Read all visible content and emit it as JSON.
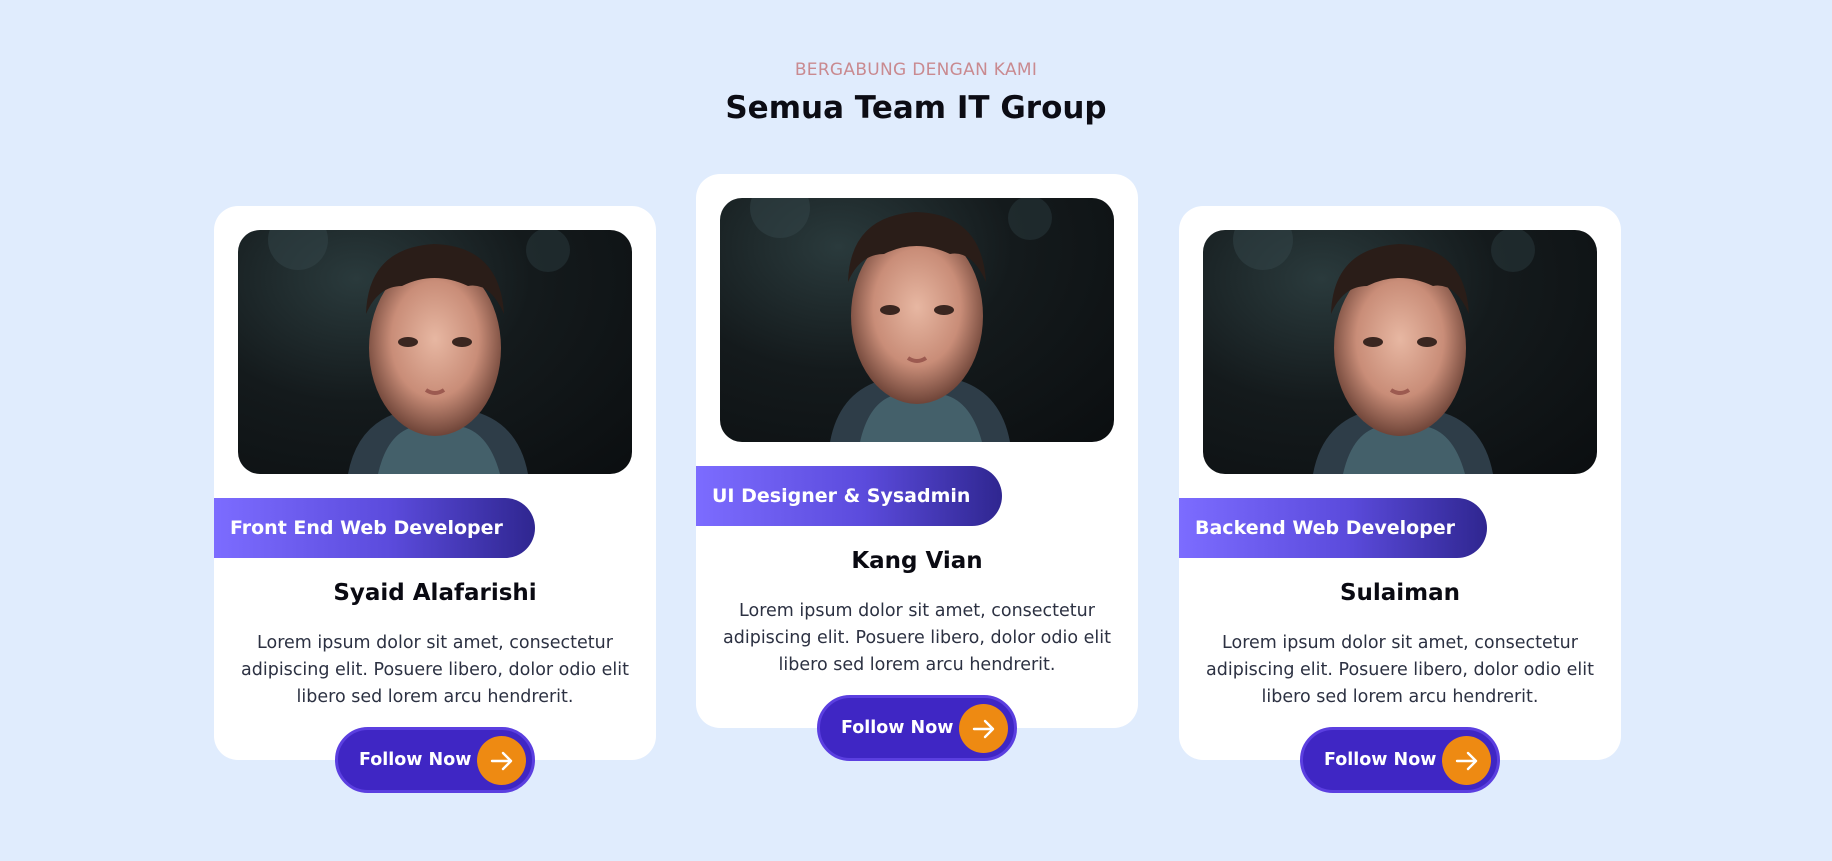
{
  "header": {
    "eyebrow": "BERGABUNG DENGAN KAMI",
    "title": "Semua Team IT Group"
  },
  "colors": {
    "background": "#e0ecfd",
    "card": "#ffffff",
    "accent_purple": "#3f26c4",
    "accent_orange": "#ee8a12",
    "role_gradient_start": "#7c6cff",
    "role_gradient_end": "#2f2690",
    "eyebrow": "#c98a90"
  },
  "cards": [
    {
      "role": "Front End Web Developer",
      "name": "Syaid Alafarishi",
      "description": "Lorem ipsum dolor sit amet, consectetur adipiscing elit. Posuere libero, dolor odio elit libero sed lorem arcu hendrerit.",
      "button_label": "Follow Now",
      "button_icon": "arrow-right-icon",
      "photo": "team-member-photo"
    },
    {
      "role": "UI Designer & Sysadmin",
      "name": "Kang Vian",
      "description": "Lorem ipsum dolor sit amet, consectetur adipiscing elit. Posuere libero, dolor odio elit libero sed lorem arcu hendrerit.",
      "button_label": "Follow Now",
      "button_icon": "arrow-right-icon",
      "photo": "team-member-photo"
    },
    {
      "role": "Backend Web Developer",
      "name": "Sulaiman",
      "description": "Lorem ipsum dolor sit amet, consectetur adipiscing elit. Posuere libero, dolor odio elit libero sed lorem arcu hendrerit.",
      "button_label": "Follow Now",
      "button_icon": "arrow-right-icon",
      "photo": "team-member-photo"
    }
  ]
}
